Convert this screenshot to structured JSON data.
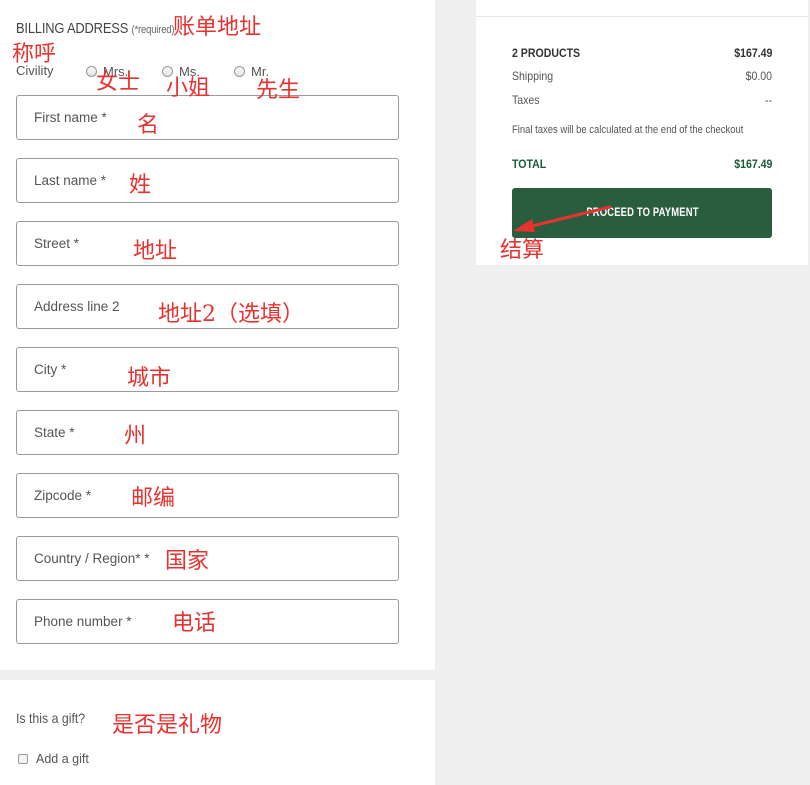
{
  "billing": {
    "title": "BILLING ADDRESS",
    "required_note": "(*required)",
    "civility_label": "Civility",
    "civility_options": [
      "Mrs.",
      "Ms.",
      "Mr."
    ],
    "fields": {
      "first_name": "First name *",
      "last_name": "Last name *",
      "street": "Street *",
      "address_line2": "Address line 2",
      "city": "City *",
      "state": "State *",
      "zipcode": "Zipcode *",
      "country": "Country / Region* *",
      "phone": "Phone number *"
    }
  },
  "gift": {
    "question": "Is this a gift?",
    "checkbox_label": "Add a gift"
  },
  "summary": {
    "products_label": "2 PRODUCTS",
    "products_value": "$167.49",
    "shipping_label": "Shipping",
    "shipping_value": "$0.00",
    "taxes_label": "Taxes",
    "taxes_value": "--",
    "final_note": "Final taxes will be calculated at the end of the checkout",
    "total_label": "TOTAL",
    "total_value": "$167.49",
    "proceed_label": "PROCEED TO PAYMENT"
  },
  "annotations": {
    "billing_address": "账单地址",
    "civility": "称呼",
    "mrs": "女士",
    "ms": "小姐",
    "mr": "先生",
    "first_name": "名",
    "last_name": "姓",
    "street": "地址",
    "address_line2": "地址2（选填）",
    "city": "城市",
    "state": "州",
    "zipcode": "邮编",
    "country": "国家",
    "phone": "电话",
    "gift": "是否是礼物",
    "checkout": "结算"
  },
  "colors": {
    "annotation_red": "#e8322f",
    "button_green": "#2a5c3e",
    "total_green": "#1d5a3a"
  }
}
